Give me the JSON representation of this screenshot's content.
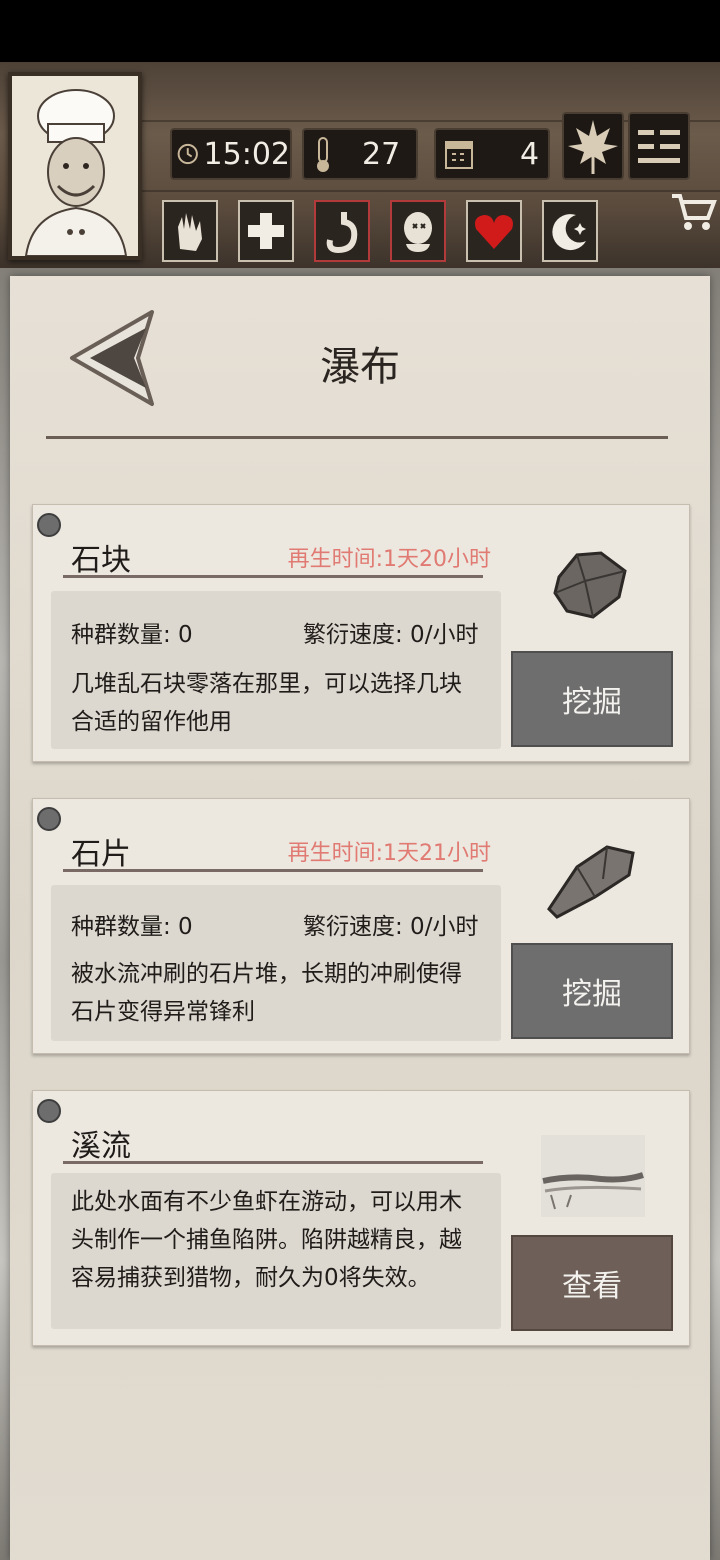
{
  "hud": {
    "time": "15:02",
    "temperature": "27",
    "day": "4"
  },
  "icons": {
    "clock": "clock-icon",
    "thermometer": "thermometer-icon",
    "calendar": "calendar-icon",
    "leaf": "leaf-icon",
    "menu": "menu-icon",
    "cart": "cart-icon",
    "status": [
      "hand-icon",
      "cross-icon",
      "stomach-icon",
      "head-icon",
      "heart-icon",
      "moon-icon"
    ]
  },
  "colors": {
    "regen_text": "#e07a72",
    "alert_border": "#b23a3a",
    "heart": "#d11a1a"
  },
  "page": {
    "title": "瀑布"
  },
  "resources": [
    {
      "name": "石块",
      "regen": "再生时间:1天20小时",
      "population": "种群数量: 0",
      "growth": "繁衍速度: 0/小时",
      "desc_lines": [
        "几堆乱石块零落在那里，可以选择几块",
        "合适的留作他用"
      ],
      "action": "挖掘"
    },
    {
      "name": "石片",
      "regen": "再生时间:1天21小时",
      "population": "种群数量: 0",
      "growth": "繁衍速度: 0/小时",
      "desc_lines": [
        "被水流冲刷的石片堆，长期的冲刷使得",
        "石片变得异常锋利"
      ],
      "action": "挖掘"
    },
    {
      "name": "溪流",
      "desc_lines": [
        "此处水面有不少鱼虾在游动，可以用木",
        "头制作一个捕鱼陷阱。陷阱越精良，越",
        "容易捕获到猎物，耐久为0将失效。"
      ],
      "action": "查看"
    }
  ]
}
